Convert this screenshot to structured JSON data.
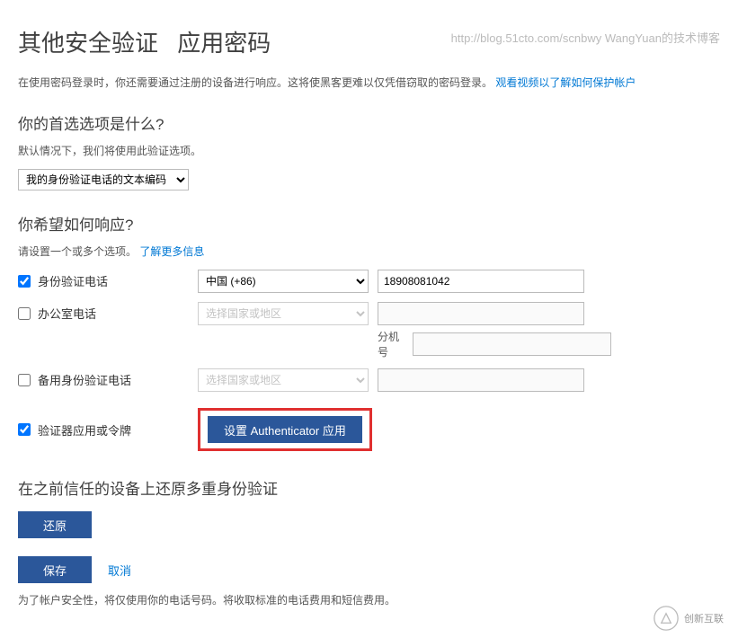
{
  "watermark": "http://blog.51cto.com/scnbwy WangYuan的技术博客",
  "title_main": "其他安全验证",
  "title_sub": "应用密码",
  "intro": "在使用密码登录时，你还需要通过注册的设备进行响应。这将使黑客更难以仅凭借窃取的密码登录。",
  "intro_link": "观看视频以了解如何保护帐户",
  "section1_heading": "你的首选选项是什么?",
  "section1_desc": "默认情况下，我们将使用此验证选项。",
  "pref_select_value": "我的身份验证电话的文本编码",
  "section2_heading": "你希望如何响应?",
  "section2_desc_prefix": "请设置一个或多个选项。",
  "section2_desc_link": "了解更多信息",
  "methods": {
    "auth_phone": {
      "label": "身份验证电话",
      "checked": true,
      "country": "中国 (+86)",
      "number": "18908081042"
    },
    "office_phone": {
      "label": "办公室电话",
      "checked": false,
      "country_placeholder": "选择国家或地区",
      "ext_label": "分机号"
    },
    "backup_phone": {
      "label": "备用身份验证电话",
      "checked": false,
      "country_placeholder": "选择国家或地区"
    },
    "authenticator": {
      "label": "验证器应用或令牌",
      "checked": true,
      "button": "设置 Authenticator 应用"
    }
  },
  "restore_heading": "在之前信任的设备上还原多重身份验证",
  "restore_button": "还原",
  "save_button": "保存",
  "cancel_link": "取消",
  "footer": "为了帐户安全性，将仅使用你的电话号码。将收取标准的电话费用和短信费用。",
  "logo_text": "创新互联"
}
